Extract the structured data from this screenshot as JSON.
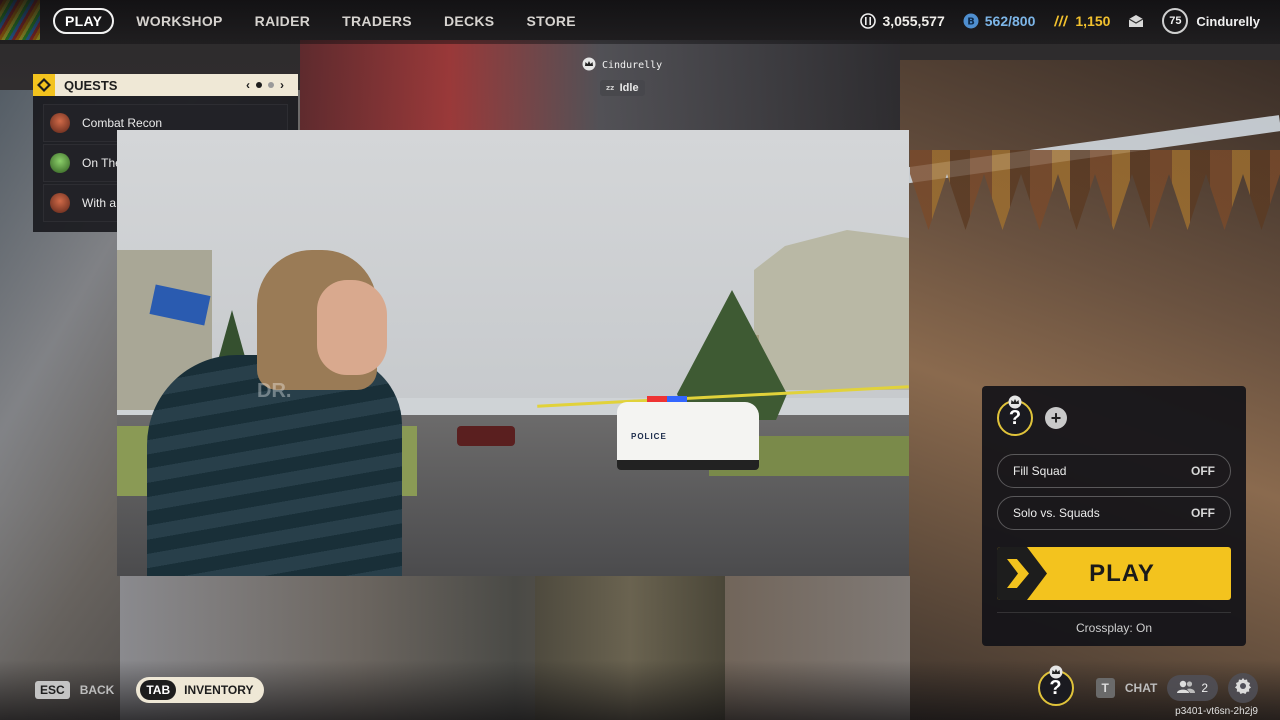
{
  "nav": {
    "items": [
      {
        "label": "PLAY",
        "active": true
      },
      {
        "label": "WORKSHOP",
        "active": false
      },
      {
        "label": "RAIDER",
        "active": false
      },
      {
        "label": "TRADERS",
        "active": false
      },
      {
        "label": "DECKS",
        "active": false
      },
      {
        "label": "STORE",
        "active": false
      }
    ]
  },
  "currencies": {
    "coins": "3,055,577",
    "blue": "562/800",
    "gold": "1,150",
    "level": "75",
    "username": "Cindurelly"
  },
  "presence": {
    "name": "Cindurelly",
    "status": "Idle"
  },
  "quests": {
    "title": "QUESTS",
    "pager_prev": "‹",
    "pager_next": "›",
    "items": [
      {
        "label": "Combat Recon"
      },
      {
        "label": "On The"
      },
      {
        "label": "With a"
      }
    ]
  },
  "video": {
    "watermark": "DR.",
    "car_text": "POLICE"
  },
  "squad": {
    "slot_label": "?",
    "fill_squad": {
      "label": "Fill Squad",
      "value": "OFF"
    },
    "solo_vs_squads": {
      "label": "Solo vs. Squads",
      "value": "OFF"
    },
    "play_label": "PLAY",
    "crossplay": "Crossplay: On"
  },
  "bottom": {
    "esc_key": "ESC",
    "back_label": "BACK",
    "tab_key": "TAB",
    "inventory_label": "INVENTORY",
    "slot_label": "?",
    "chat_key": "T",
    "chat_label": "CHAT",
    "friends_count": "2",
    "build_id": "p3401-vt6sn-2h2j9"
  },
  "colors": {
    "accent_yellow": "#f3c31e",
    "panel_dark": "#121218",
    "quest_header": "#efe8d6"
  }
}
